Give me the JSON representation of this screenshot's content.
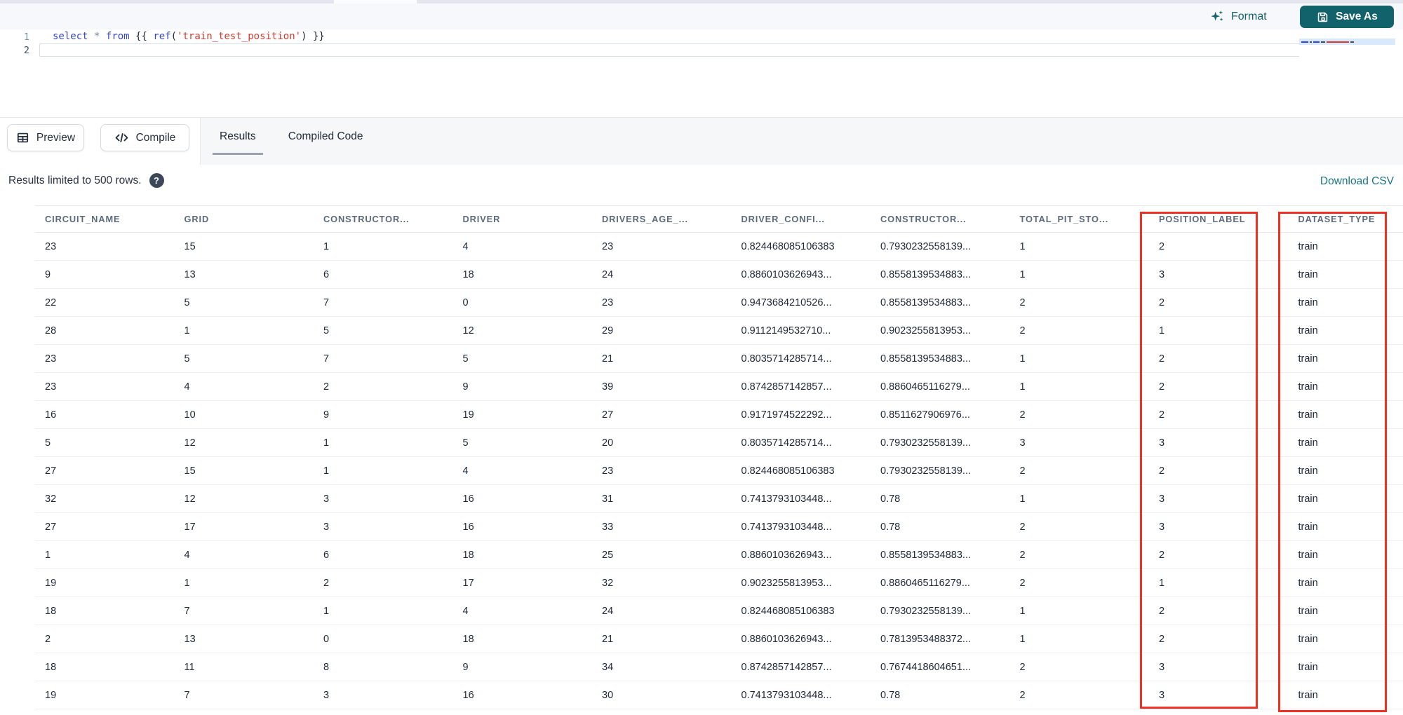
{
  "header": {
    "format_label": "Format",
    "save_as_label": "Save As"
  },
  "editor": {
    "line1_number": "1",
    "line2_number": "2",
    "code_tokens": [
      {
        "text": "select",
        "cls": "kw"
      },
      {
        "text": " ",
        "cls": "pl"
      },
      {
        "text": "*",
        "cls": "op"
      },
      {
        "text": " ",
        "cls": "pl"
      },
      {
        "text": "from",
        "cls": "kw"
      },
      {
        "text": " {{ ",
        "cls": "pl"
      },
      {
        "text": "ref",
        "cls": "kw"
      },
      {
        "text": "(",
        "cls": "pl"
      },
      {
        "text": "'train_test_position'",
        "cls": "str"
      },
      {
        "text": ")",
        "cls": "pl"
      },
      {
        "text": " }}",
        "cls": "pl"
      }
    ]
  },
  "toolbar": {
    "preview_label": "Preview",
    "compile_label": "Compile",
    "tabs": [
      {
        "label": "Results",
        "active": true
      },
      {
        "label": "Compiled Code",
        "active": false
      }
    ]
  },
  "results_bar": {
    "info_text": "Results limited to 500 rows.",
    "help_glyph": "?",
    "download_label": "Download CSV"
  },
  "table": {
    "columns": [
      "CIRCUIT_NAME",
      "GRID",
      "CONSTRUCTOR...",
      "DRIVER",
      "DRIVERS_AGE_...",
      "DRIVER_CONFI...",
      "CONSTRUCTOR...",
      "TOTAL_PIT_STO...",
      "POSITION_LABEL",
      "DATASET_TYPE"
    ],
    "rows": [
      [
        "23",
        "15",
        "1",
        "4",
        "23",
        "0.824468085106383",
        "0.7930232558139...",
        "1",
        "2",
        "train"
      ],
      [
        "9",
        "13",
        "6",
        "18",
        "24",
        "0.8860103626943...",
        "0.8558139534883...",
        "1",
        "3",
        "train"
      ],
      [
        "22",
        "5",
        "7",
        "0",
        "23",
        "0.9473684210526...",
        "0.8558139534883...",
        "2",
        "2",
        "train"
      ],
      [
        "28",
        "1",
        "5",
        "12",
        "29",
        "0.9112149532710...",
        "0.9023255813953...",
        "2",
        "1",
        "train"
      ],
      [
        "23",
        "5",
        "7",
        "5",
        "21",
        "0.8035714285714...",
        "0.8558139534883...",
        "1",
        "2",
        "train"
      ],
      [
        "23",
        "4",
        "2",
        "9",
        "39",
        "0.8742857142857...",
        "0.8860465116279...",
        "1",
        "2",
        "train"
      ],
      [
        "16",
        "10",
        "9",
        "19",
        "27",
        "0.9171974522292...",
        "0.8511627906976...",
        "2",
        "2",
        "train"
      ],
      [
        "5",
        "12",
        "1",
        "5",
        "20",
        "0.8035714285714...",
        "0.7930232558139...",
        "3",
        "3",
        "train"
      ],
      [
        "27",
        "15",
        "1",
        "4",
        "23",
        "0.824468085106383",
        "0.7930232558139...",
        "2",
        "2",
        "train"
      ],
      [
        "32",
        "12",
        "3",
        "16",
        "31",
        "0.7413793103448...",
        "0.78",
        "1",
        "3",
        "train"
      ],
      [
        "27",
        "17",
        "3",
        "16",
        "33",
        "0.7413793103448...",
        "0.78",
        "2",
        "3",
        "train"
      ],
      [
        "1",
        "4",
        "6",
        "18",
        "25",
        "0.8860103626943...",
        "0.8558139534883...",
        "2",
        "2",
        "train"
      ],
      [
        "19",
        "1",
        "2",
        "17",
        "32",
        "0.9023255813953...",
        "0.8860465116279...",
        "2",
        "1",
        "train"
      ],
      [
        "18",
        "7",
        "1",
        "4",
        "24",
        "0.824468085106383",
        "0.7930232558139...",
        "1",
        "2",
        "train"
      ],
      [
        "2",
        "13",
        "0",
        "18",
        "21",
        "0.8860103626943...",
        "0.7813953488372...",
        "1",
        "2",
        "train"
      ],
      [
        "18",
        "11",
        "8",
        "9",
        "34",
        "0.8742857142857...",
        "0.7674418604651...",
        "2",
        "3",
        "train"
      ],
      [
        "19",
        "7",
        "3",
        "16",
        "30",
        "0.7413793103448...",
        "0.78",
        "2",
        "3",
        "train"
      ]
    ]
  },
  "annotations": {
    "highlight_color": "#ef3124",
    "highlighted_columns": [
      "POSITION_LABEL",
      "DATASET_TYPE"
    ]
  },
  "colors": {
    "accent_teal": "#11626b",
    "link_teal": "#1b7586",
    "annotation_red": "#ef3124"
  }
}
